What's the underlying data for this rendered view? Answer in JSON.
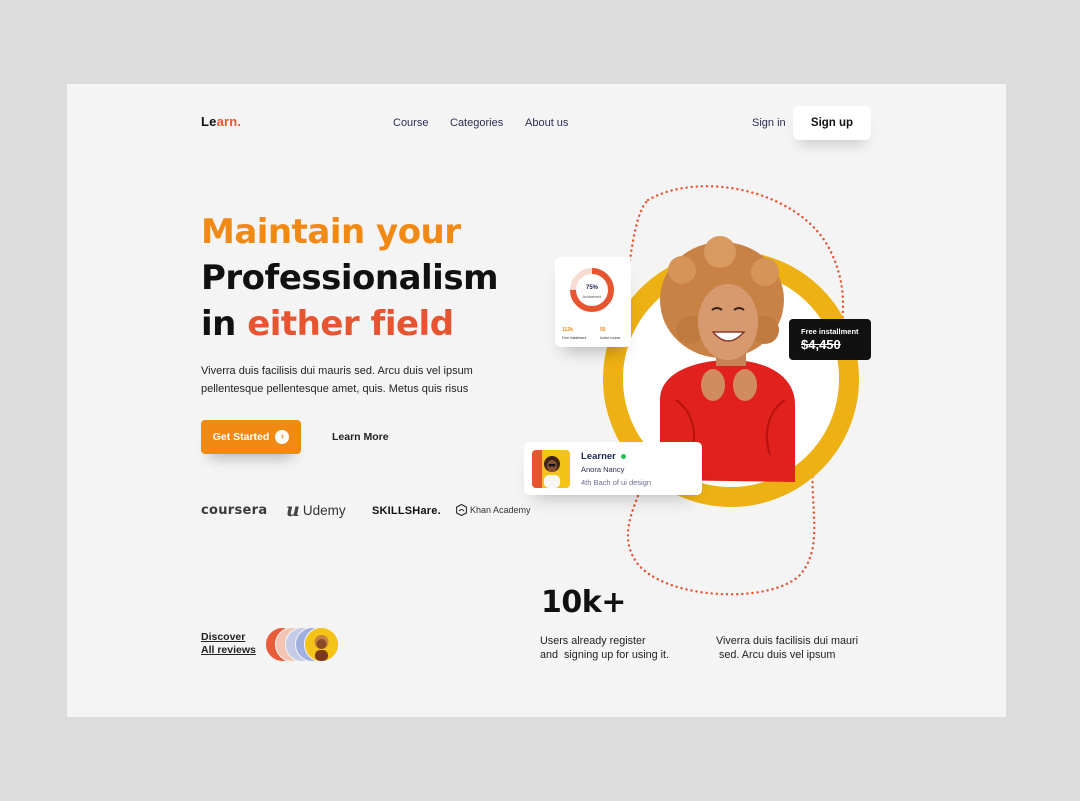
{
  "header": {
    "logo_prefix": "Le",
    "logo_accent": "arn.",
    "nav": [
      "Course",
      "Categories",
      "About us"
    ],
    "sign_in": "Sign in",
    "sign_up": "Sign up"
  },
  "hero": {
    "line1": "Maintain your",
    "line2": "Professionalism",
    "line3_plain": "in ",
    "line3_accent": "either field",
    "description": "Viverra duis facilisis dui mauris sed. Arcu duis vel ipsum pellentesque pellentesque amet, quis. Metus quis risus",
    "cta_primary": "Get Started",
    "cta_secondary": "Learn More"
  },
  "partners": {
    "coursera": "coursera",
    "udemy": "Udemy",
    "skillshare": "SKILLSHare.",
    "khan": "Khan Academy"
  },
  "reviews": {
    "line1": "Discover",
    "line2": "All reviews"
  },
  "stats": {
    "number": "10k+",
    "desc1_line1": "Users already register",
    "desc1_line2": "and  signing up for using it.",
    "desc2_line1": "Viverra duis facilisis dui mauri",
    "desc2_line2": " sed. Arcu duis vel ipsum"
  },
  "chart_card": {
    "percent_label": "75%",
    "percent_value": 75,
    "sub_label": "Achivement",
    "stat1_value": "112k",
    "stat1_label": "Free Installment",
    "stat2_value": "50",
    "stat2_label": "Active course"
  },
  "price_card": {
    "label": "Free installment",
    "price": "$4,450"
  },
  "learner_card": {
    "title": "Learner",
    "name": "Anora Nancy",
    "subtitle": "4th Bach of ui design"
  },
  "colors": {
    "orange": "#f08a14",
    "red": "#e65430",
    "yellow_ring": "#eeb113",
    "navy": "#2a2f55"
  }
}
